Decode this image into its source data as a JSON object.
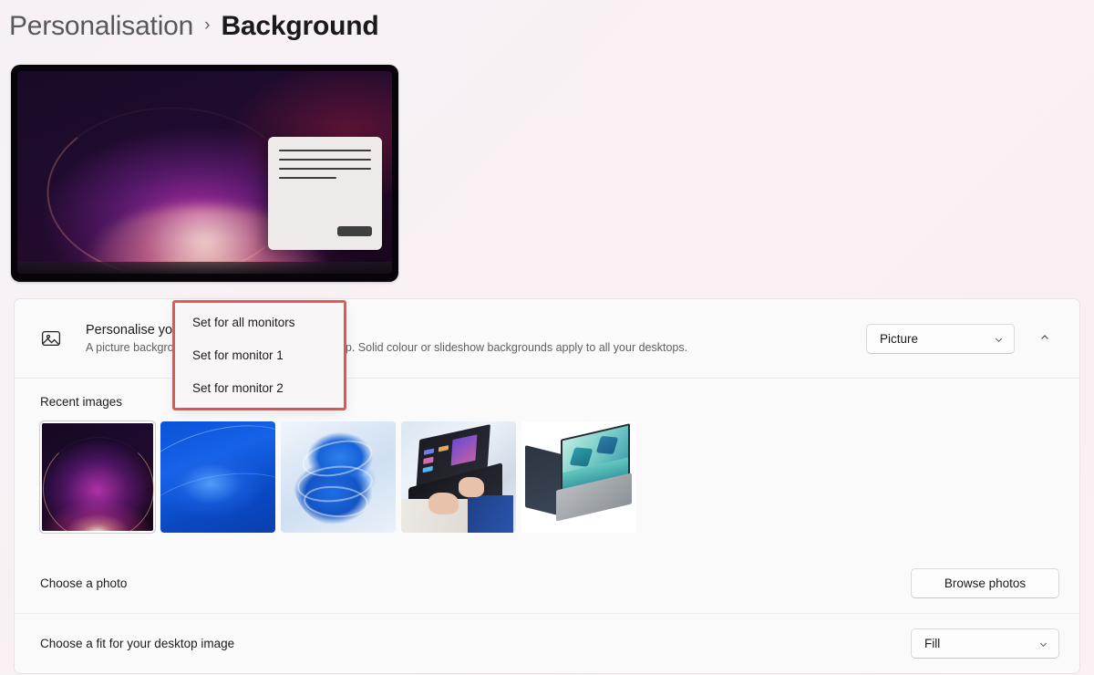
{
  "breadcrumb": {
    "root": "Personalisation",
    "separator": "›",
    "current": "Background"
  },
  "preview": {
    "name": "desktop-preview",
    "wallpaper": "purple-bloom-crescent"
  },
  "background_row": {
    "icon": "picture-icon",
    "title": "Personalise your background",
    "subtitle": "A picture background applies to your current desktop. Solid colour or slideshow backgrounds apply to all your desktops.",
    "dropdown_value": "Picture",
    "expander_state": "expanded"
  },
  "recent_images": {
    "label": "Recent images",
    "thumbnails": [
      {
        "name": "purple-bloom",
        "selected": true
      },
      {
        "name": "blue-abstract-swirl",
        "selected": false
      },
      {
        "name": "windows11-blue-bloom",
        "selected": false
      },
      {
        "name": "person-typing-laptop",
        "selected": false
      },
      {
        "name": "laptop-product-photo",
        "selected": false
      }
    ]
  },
  "choose_photo_row": {
    "label": "Choose a photo",
    "button_label": "Browse photos"
  },
  "fit_row": {
    "label": "Choose a fit for your desktop image",
    "dropdown_value": "Fill"
  },
  "context_menu": {
    "highlight_colour": "#ea5c59",
    "items": [
      {
        "label": "Set for all monitors"
      },
      {
        "label": "Set for monitor 1"
      },
      {
        "label": "Set for monitor 2"
      }
    ]
  },
  "colours": {
    "page_background": "#f8f1f5",
    "card_background": "#fbfafb",
    "text_primary": "#1b1b1b",
    "text_secondary": "#60605f",
    "highlight_red": "#ea5c59"
  }
}
